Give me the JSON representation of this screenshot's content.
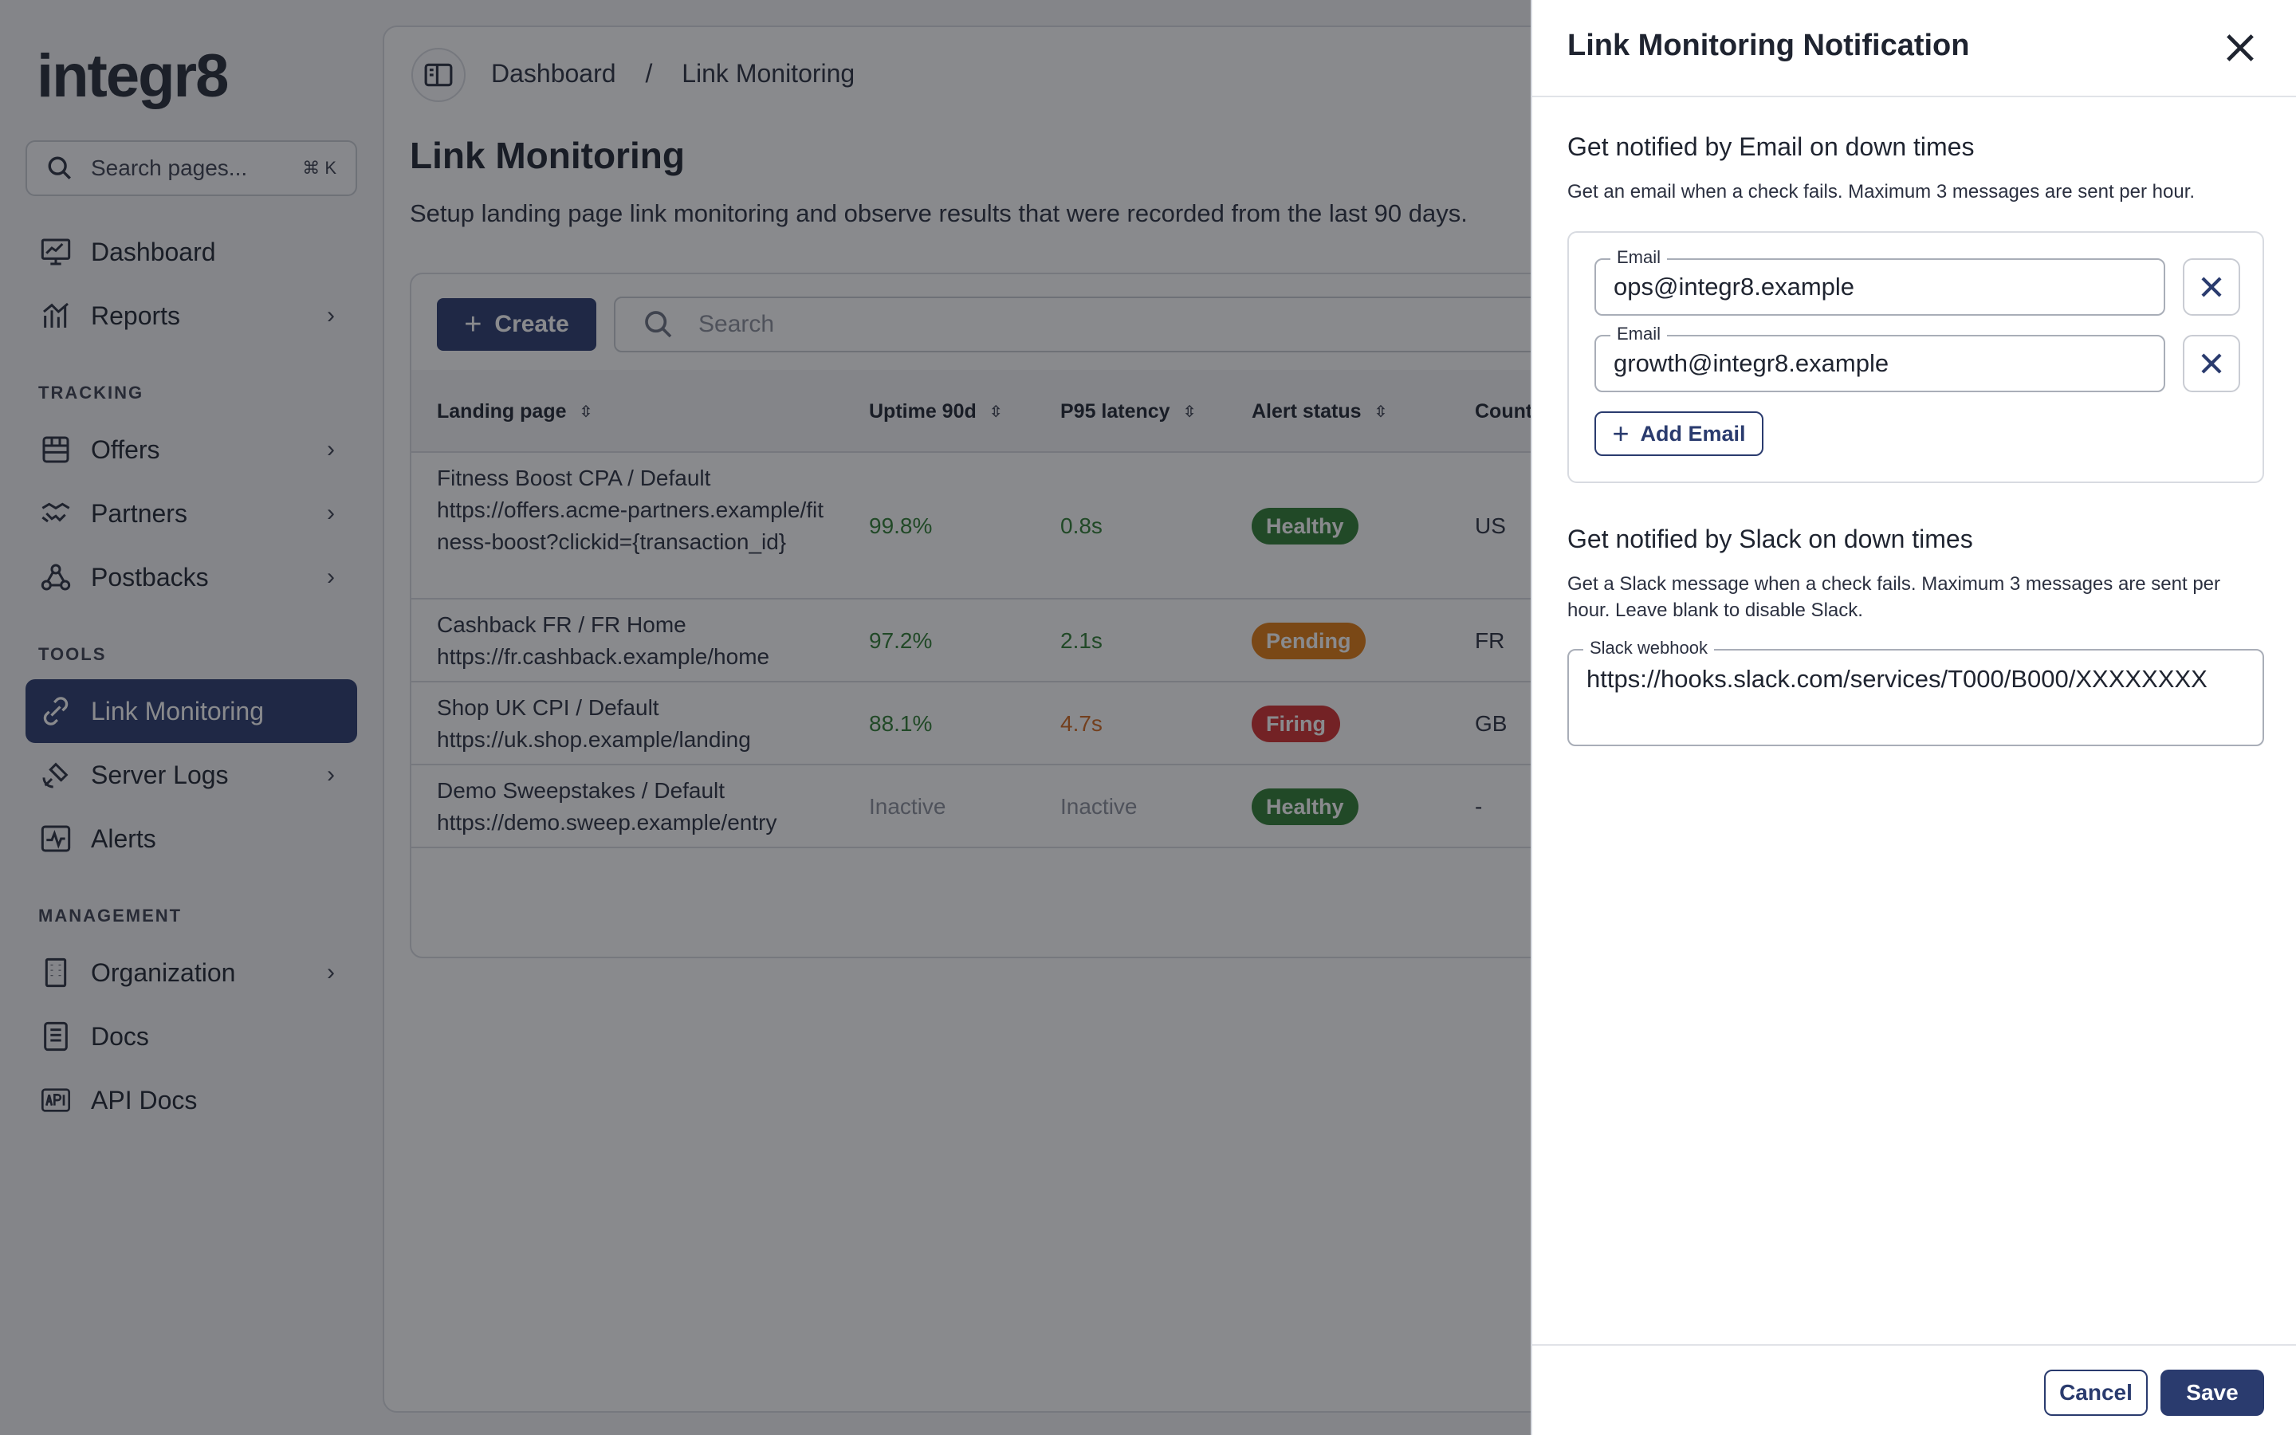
{
  "app": {
    "logo_text": "integr8"
  },
  "sidebar": {
    "search_placeholder": "Search pages...",
    "search_shortcut": "⌘ K",
    "items": [
      {
        "label": "Dashboard",
        "icon": "monitor-chart-icon"
      },
      {
        "label": "Reports",
        "icon": "bar-chart-icon"
      },
      {
        "label": "Offers",
        "icon": "store-icon"
      },
      {
        "label": "Partners",
        "icon": "handshake-icon"
      },
      {
        "label": "Postbacks",
        "icon": "webhook-icon"
      },
      {
        "label": "Link Monitoring",
        "icon": "link-monitor-icon"
      },
      {
        "label": "Server Logs",
        "icon": "satellite-icon"
      },
      {
        "label": "Alerts",
        "icon": "activity-icon"
      },
      {
        "label": "Organization",
        "icon": "building-icon"
      },
      {
        "label": "Docs",
        "icon": "document-icon"
      },
      {
        "label": "API Docs",
        "icon": "api-icon"
      }
    ],
    "sections": {
      "tracking": "TRACKING",
      "tools": "TOOLS",
      "management": "MANAGEMENT"
    }
  },
  "header": {
    "breadcrumb": [
      "Dashboard",
      "/",
      "Link Monitoring"
    ]
  },
  "page": {
    "title": "Link Monitoring",
    "subtitle": "Setup landing page link monitoring and observe results that were recorded from the last 90 days."
  },
  "toolbar": {
    "create_label": "Create",
    "search_placeholder": "Search"
  },
  "table": {
    "columns": [
      "Landing page",
      "Uptime 90d",
      "P95 latency",
      "Alert status",
      "Count"
    ],
    "rows": [
      {
        "landing": "Fitness Boost CPA / Default",
        "url": "https://offers.acme-partners.example/fitness-boost?clickid={transaction_id}",
        "uptime": "99.8%",
        "latency": "0.8s",
        "status": "Healthy",
        "country": "US"
      },
      {
        "landing": "Cashback FR / FR Home",
        "url": "https://fr.cashback.example/home",
        "uptime": "97.2%",
        "latency": "2.1s",
        "status": "Pending",
        "country": "FR"
      },
      {
        "landing": "Shop UK CPI / Default",
        "url": "https://uk.shop.example/landing",
        "uptime": "88.1%",
        "latency": "4.7s",
        "status": "Firing",
        "country": "GB"
      },
      {
        "landing": "Demo Sweepstakes / Default",
        "url": "https://demo.sweep.example/entry",
        "uptime": "Inactive",
        "latency": "Inactive",
        "status": "Healthy",
        "country": "-"
      }
    ]
  },
  "drawer": {
    "title": "Link Monitoring Notification",
    "email_section": {
      "heading": "Get notified by Email on down times",
      "description": "Get an email when a check fails. Maximum 3 messages are sent per hour.",
      "field_label": "Email",
      "emails": [
        "ops@integr8.example",
        "growth@integr8.example"
      ],
      "add_label": "Add Email"
    },
    "slack_section": {
      "heading": "Get notified by Slack on down times",
      "description": "Get a Slack message when a check fails. Maximum 3 messages are sent per hour. Leave blank to disable Slack.",
      "field_label": "Slack webhook",
      "value": "https://hooks.slack.com/services/T000/B000/XXXXXXXX"
    },
    "cancel_label": "Cancel",
    "save_label": "Save"
  },
  "colors": {
    "accent": "#2a3b6e",
    "healthy": "#2e7d32",
    "pending": "#e07a10",
    "firing": "#d32f2f"
  }
}
